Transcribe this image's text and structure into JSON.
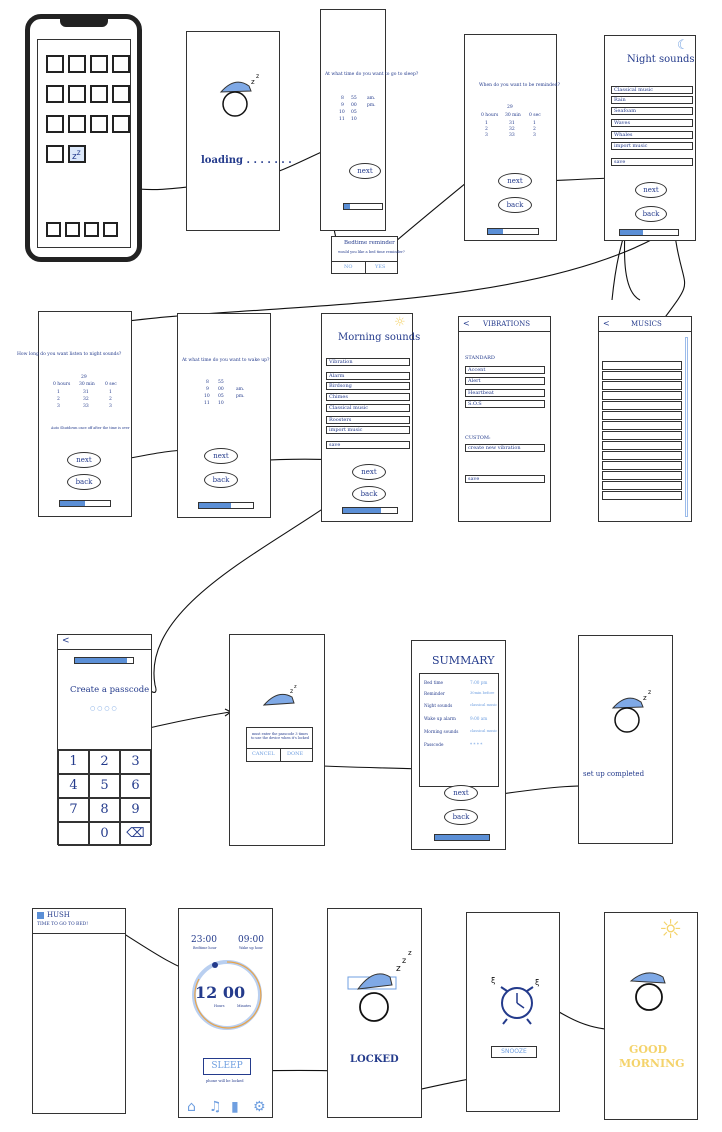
{
  "colors": {
    "ink": "#243b8c",
    "accent": "#5b8fd6",
    "sun": "#f4d36b"
  },
  "s1": {
    "loading": "loading . . . . . . ."
  },
  "s2": {
    "title": "At what time do you want to go to sleep?",
    "times": [
      [
        "8",
        "55",
        ""
      ],
      [
        "9",
        "00",
        "am."
      ],
      [
        "10",
        "05",
        "pm."
      ],
      [
        "11",
        "10",
        ""
      ]
    ],
    "next": "next",
    "popup_title": "Bedtime reminder",
    "popup_text": "would you like a bed time reminder?",
    "popup_no": "NO",
    "popup_yes": "YES"
  },
  "s3": {
    "title": "When do you want to be reminded?",
    "top": "29",
    "head": [
      "0 hours",
      "30 min",
      "0 sec"
    ],
    "rows": [
      [
        "1",
        "31",
        "1"
      ],
      [
        "2",
        "32",
        "2"
      ],
      [
        "3",
        "33",
        "3"
      ]
    ],
    "next": "next",
    "back": "back"
  },
  "s4": {
    "title": "Night sounds",
    "items": [
      "Classical music",
      "Rain",
      "Seafoam",
      "Waves",
      "Whales"
    ],
    "import": "import music",
    "save": "save",
    "next": "next",
    "back": "back"
  },
  "s5": {
    "title": "How long do you want listen to night sounds?",
    "top": "29",
    "head": [
      "0 hours",
      "30 min",
      "0 sec"
    ],
    "rows": [
      [
        "1",
        "31",
        "1"
      ],
      [
        "2",
        "32",
        "2"
      ],
      [
        "3",
        "33",
        "3"
      ]
    ],
    "note": "Auto Shutdown once off after the time is over",
    "next": "next",
    "back": "back"
  },
  "s6": {
    "title": "At what time do you want to wake up?",
    "times": [
      [
        "8",
        "55",
        ""
      ],
      [
        "9",
        "00",
        "am."
      ],
      [
        "10",
        "05",
        "pm."
      ],
      [
        "11",
        "10",
        ""
      ]
    ],
    "next": "next",
    "back": "back"
  },
  "s7": {
    "title": "Morning sounds",
    "vibration": "Vibration",
    "items": [
      "Alarm",
      "Birdsong",
      "Chimes",
      "Classical music",
      "Roosters"
    ],
    "import": "import music",
    "save": "save",
    "next": "next",
    "back": "back"
  },
  "s8": {
    "header": "VIBRATIONS",
    "back": "<",
    "standard": "STANDARD",
    "items": [
      "Accent",
      "Alert",
      "Heartbeat",
      "S.O.S"
    ],
    "custom": "CUSTOM:",
    "create": "create new vibration",
    "save": "save"
  },
  "s9": {
    "header": "MUSICS",
    "back": "<"
  },
  "s10": {
    "back": "<",
    "title": "Create a passcode",
    "dots": "○ ○ ○ ○",
    "keys": [
      "1",
      "2",
      "3",
      "4",
      "5",
      "6",
      "7",
      "8",
      "9",
      "",
      "0",
      "⌫"
    ]
  },
  "s11": {
    "text": "must enter the passcode 3 times to use the device when it's locked",
    "cancel": "CANCEL",
    "done": "DONE"
  },
  "s12": {
    "title": "SUMMARY",
    "rows": [
      [
        "Bed time",
        "7:00 pm"
      ],
      [
        "Reminder",
        "30min before"
      ],
      [
        "Night sounds",
        "classical music"
      ],
      [
        "Wake up alarm",
        "9:00 am"
      ],
      [
        "Morning sounds",
        "classical music"
      ],
      [
        "Passcode",
        "* * * *"
      ]
    ],
    "next": "next",
    "back": "back"
  },
  "s13": {
    "text": "set up completed"
  },
  "s14": {
    "app": "HUSH",
    "sub": "TIME TO GO TO BED!"
  },
  "s15": {
    "bed": "23:00",
    "bed_label": "Bedtime hour",
    "wake": "09:00",
    "wake_label": "Wake up hour",
    "big": "12 00",
    "hours": "Hours",
    "minutes": "Minutes",
    "sleep": "SLEEP",
    "sleep_note": "phone will be locked"
  },
  "s16": {
    "text": "LOCKED"
  },
  "s17": {
    "snooze": "SNOOZE"
  },
  "s18": {
    "text1": "GOOD",
    "text2": "MORNING"
  }
}
